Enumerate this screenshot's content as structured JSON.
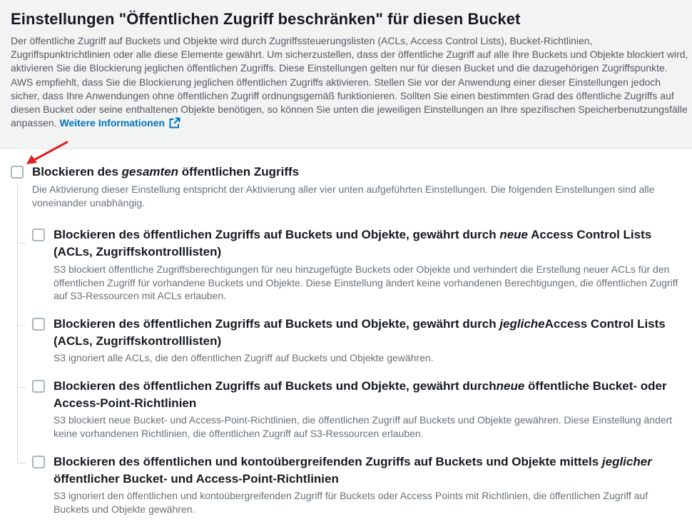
{
  "header": {
    "title": "Einstellungen \"Öffentlichen Zugriff beschränken\" für diesen Bucket",
    "description": "Der öffentliche Zugriff auf Buckets und Objekte wird durch Zugriffssteuerungslisten (ACLs, Access Control Lists), Bucket-Richtlinien, Zugriffspunktrichtlinien oder alle diese Elemente gewährt. Um sicherzustellen, dass der öffentliche Zugriff auf alle Ihre Buckets und Objekte blockiert wird, aktivieren Sie die Blockierung jeglichen öffentlichen Zugriffs. Diese Einstellungen gelten nur für diesen Bucket und die dazugehörigen Zugriffspunkte. AWS empfiehlt, dass Sie die Blockierung jeglichen öffentlichen Zugriffs aktivieren. Stellen Sie vor der Anwendung einer dieser Einstellungen jedoch sicher, dass Ihre Anwendungen ohne öffentlichen Zugriff ordnungsgemäß funktionieren. Sollten Sie einen bestimmten Grad des öffentliche Zugriffs auf diesen Bucket oder seine enthaltenen Objekte benötigen, so können Sie unten die jeweiligen Einstellungen an Ihre spezifischen Speicherbenutzungsfälle anpassen.",
    "link_label": "Weitere Informationen",
    "link_icon": "external-link-icon"
  },
  "block_all": {
    "title_pre": "Blockieren des ",
    "title_em": "gesamten",
    "title_post": " öffentlichen Zugriffs",
    "description": "Die Aktivierung dieser Einstellung entspricht der Aktivierung aller vier unten aufgeführten Einstellungen. Die folgenden Einstellungen sind alle voneinander unabhängig.",
    "checked": false
  },
  "options": [
    {
      "title_pre": "Blockieren des öffentlichen Zugriffs auf Buckets und Objekte, gewährt durch ",
      "title_em": "neue",
      "title_post": " Access Control Lists (ACLs, Zugriffskontrolllisten)",
      "description": "S3 blockiert öffentliche Zugriffsberechtigungen für neu hinzugefügte Buckets oder Objekte und verhindert die Erstellung neuer ACLs für den öffentlichen Zugriff für vorhandene Buckets und Objekte. Diese Einstellung ändert keine vorhandenen Berechtigungen, die öffentlichen Zugriff auf S3-Ressourcen mit ACLs erlauben.",
      "checked": false
    },
    {
      "title_pre": "Blockieren des öffentlichen Zugriffs auf Buckets und Objekte, gewährt durch ",
      "title_em": "jegliche",
      "title_post": "Access Control Lists (ACLs, Zugriffskontrolllisten)",
      "description": "S3 ignoriert alle ACLs, die den öffentlichen Zugriff auf Buckets und Objekte gewähren.",
      "checked": false
    },
    {
      "title_pre": "Blockieren des öffentlichen Zugriffs auf Buckets und Objekte, gewährt durch",
      "title_em": "neue",
      "title_post": " öffentliche Bucket- oder Access-Point-Richtlinien",
      "description": "S3 blockiert neue Bucket- und Access-Point-Richtlinien, die öffentlichen Zugriff auf Buckets und Objekte gewähren. Diese Einstellung ändert keine vorhandenen Richtlinien, die öffentlichen Zugriff auf S3-Ressourcen erlauben.",
      "checked": false
    },
    {
      "title_pre": "Blockieren des öffentlichen und kontoübergreifenden Zugriffs auf Buckets und Objekte mittels ",
      "title_em": "jeglicher",
      "title_post": " öffentlicher Bucket- und Access-Point-Richtlinien",
      "description": "S3 ignoriert den öffentlichen und kontoübergreifenden Zugriff für Buckets oder Access Points mit Richtlinien, die öffentlichen Zugriff auf Buckets und Objekte gewähren.",
      "checked": false
    }
  ],
  "colors": {
    "link": "#0073bb",
    "annotation_arrow": "#e02020",
    "header_bg": "#f2f3f3"
  }
}
